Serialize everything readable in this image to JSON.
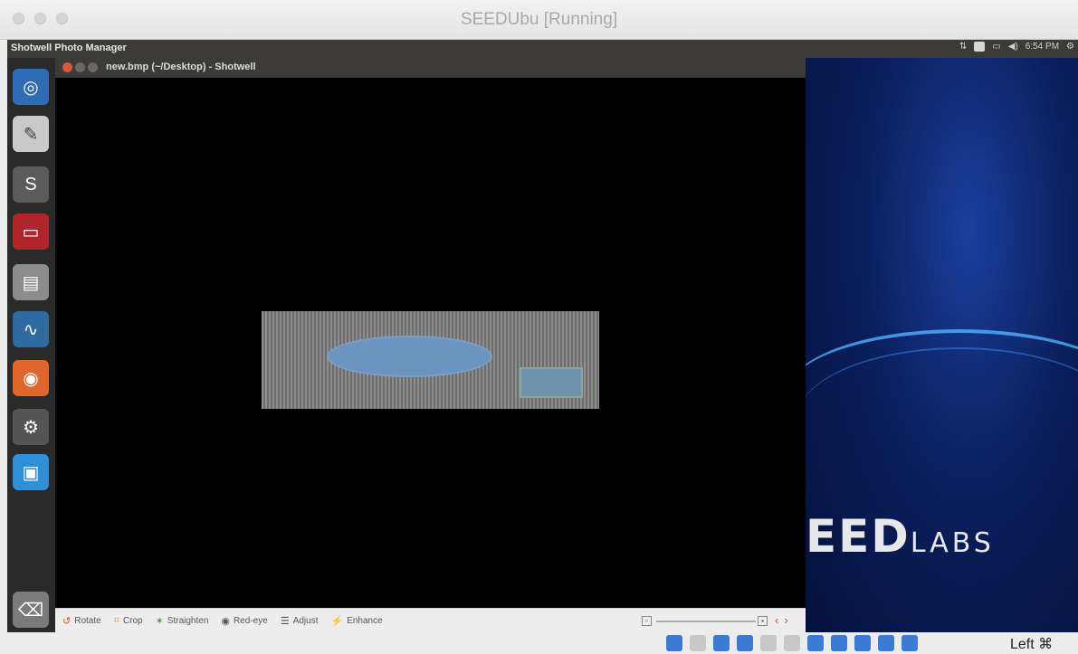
{
  "host_window": {
    "title": "SEEDUbu [Running]",
    "host_key_label": "Left ⌘"
  },
  "top_panel": {
    "app_title": "Shotwell Photo Manager",
    "clock": "6:54 PM"
  },
  "launcher": {
    "items": [
      {
        "name": "ubuntu-dash",
        "icon": "ubuntu-icon",
        "color": "#2e6db5",
        "glyph": "◎"
      },
      {
        "name": "text-editor",
        "icon": "text-editor-icon",
        "color": "#c9c9c9",
        "glyph": "✎"
      },
      {
        "name": "sublime",
        "icon": "sublime-icon",
        "color": "#5b5b5b",
        "glyph": "S"
      },
      {
        "name": "terminal",
        "icon": "terminal-icon",
        "color": "#b0252a",
        "glyph": "▭"
      },
      {
        "name": "file-archiver",
        "icon": "archive-icon",
        "color": "#8c8c8c",
        "glyph": "▤"
      },
      {
        "name": "wireshark",
        "icon": "wireshark-icon",
        "color": "#2f6aa0",
        "glyph": "∿"
      },
      {
        "name": "firefox",
        "icon": "firefox-icon",
        "color": "#e0662b",
        "glyph": "◉"
      },
      {
        "name": "settings",
        "icon": "settings-icon",
        "color": "#555",
        "glyph": "⚙"
      },
      {
        "name": "shotwell",
        "icon": "shotwell-icon",
        "color": "#2d8fd5",
        "glyph": "▣"
      },
      {
        "name": "trash",
        "icon": "trash-icon",
        "color": "#7a7a7a",
        "glyph": "🗑"
      }
    ]
  },
  "shotwell": {
    "window_title": "new.bmp (~/Desktop) - Shotwell",
    "toolbar": {
      "rotate": "Rotate",
      "crop": "Crop",
      "straighten": "Straighten",
      "red_eye": "Red-eye",
      "adjust": "Adjust",
      "enhance": "Enhance"
    }
  },
  "wallpaper": {
    "logo_main": "EED",
    "logo_labs": "LABS"
  }
}
